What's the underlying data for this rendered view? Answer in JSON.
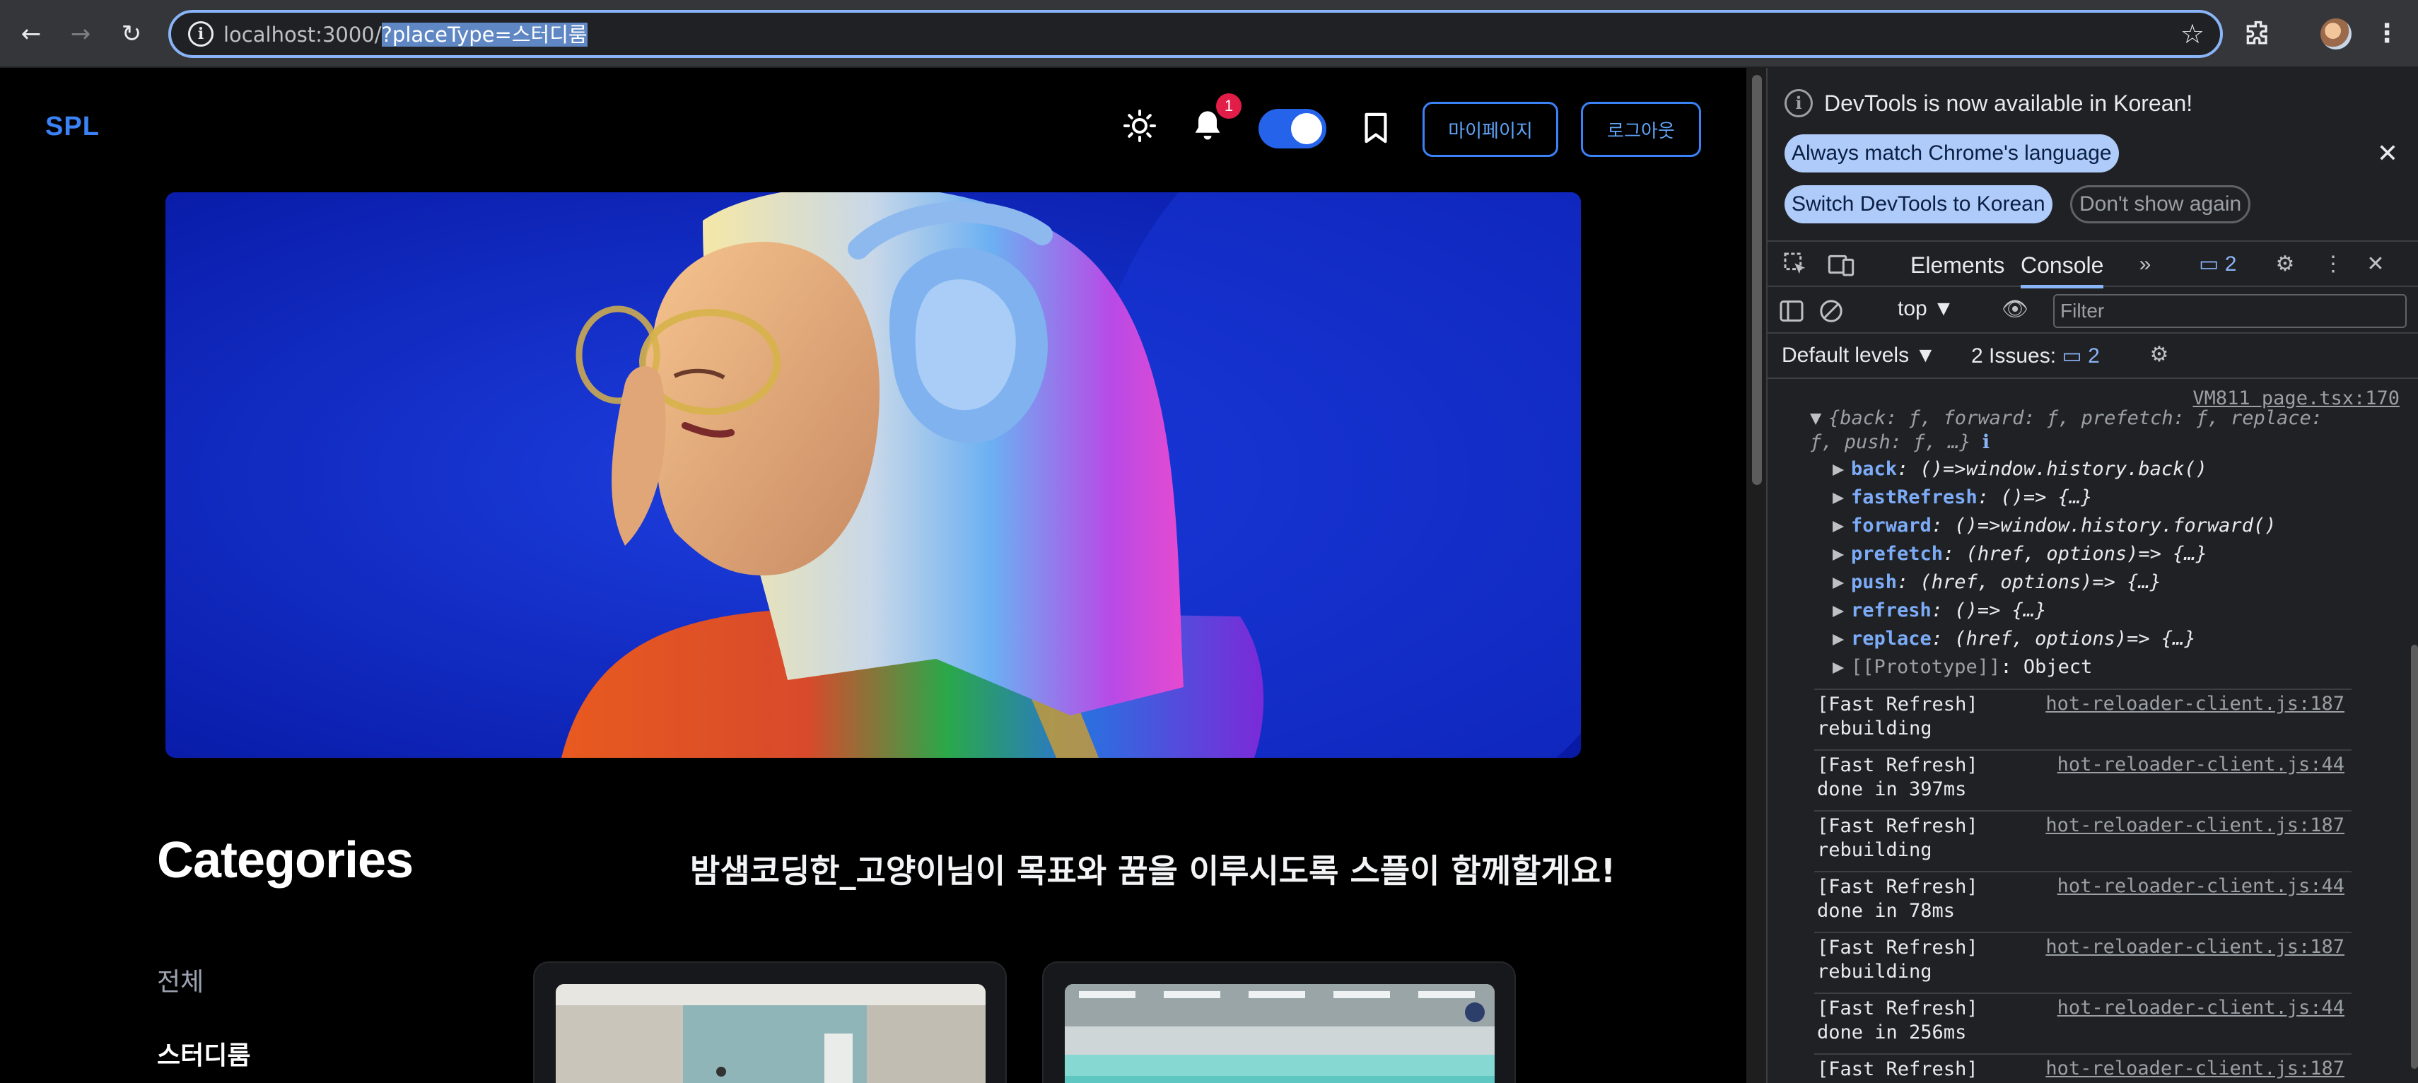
{
  "browser": {
    "url_host": "localhost:3000/",
    "url_query": "?placeType=스터디룸"
  },
  "header": {
    "logo": "SPL",
    "notification_count": "1",
    "mypage_label": "마이페이지",
    "logout_label": "로그아웃"
  },
  "main": {
    "categories_title": "Categories",
    "tagline": "밤샘코딩한_고양이님이 목표와 꿈을 이루시도록 스플이 함께할게요!",
    "sidebar": [
      {
        "label": "전체"
      },
      {
        "label": "스터디룸"
      }
    ]
  },
  "devtools": {
    "banner": "DevTools is now available in Korean!",
    "btn_match": "Always match Chrome's language",
    "btn_switch": "Switch DevTools to Korean",
    "btn_dont_show": "Don't show again",
    "tabs": [
      "Elements",
      "Console"
    ],
    "issue_badge": "2",
    "context": "top",
    "filter_placeholder": "Filter",
    "levels": "Default levels",
    "issues_label": "2 Issues:",
    "issues_count": "2",
    "console": {
      "source_vm": "VM811 page.tsx:170",
      "object_head_1": "{back: ƒ, forward: ƒ, prefetch: ƒ, replace:",
      "object_head_2": "ƒ, push: ƒ, …}",
      "props": [
        {
          "key": "back",
          "value": ": ()=>window.history.back()"
        },
        {
          "key": "fastRefresh",
          "value": ": ()=> {…}"
        },
        {
          "key": "forward",
          "value": ": ()=>window.history.forward()"
        },
        {
          "key": "prefetch",
          "value": ": (href, options)=> {…}"
        },
        {
          "key": "push",
          "value": ": (href, options)=> {…}"
        },
        {
          "key": "refresh",
          "value": ": ()=> {…}"
        },
        {
          "key": "replace",
          "value": ": (href, options)=> {…}"
        },
        {
          "key": "[[Prototype]]",
          "value": ": Object"
        }
      ],
      "logs": [
        {
          "text": "[Fast Refresh]\nrebuilding",
          "src": "hot-reloader-client.js:187"
        },
        {
          "text": "[Fast Refresh]\ndone in 397ms",
          "src": "hot-reloader-client.js:44"
        },
        {
          "text": "[Fast Refresh]\nrebuilding",
          "src": "hot-reloader-client.js:187"
        },
        {
          "text": "[Fast Refresh]\ndone in 78ms",
          "src": "hot-reloader-client.js:44"
        },
        {
          "text": "[Fast Refresh]\nrebuilding",
          "src": "hot-reloader-client.js:187"
        },
        {
          "text": "[Fast Refresh]\ndone in 256ms",
          "src": "hot-reloader-client.js:44"
        },
        {
          "text": "[Fast Refresh]",
          "src": "hot-reloader-client.js:187"
        }
      ]
    }
  },
  "colors": {
    "accent": "#3b82f6",
    "badge": "#e11d48",
    "devtools_bg": "#202124"
  }
}
